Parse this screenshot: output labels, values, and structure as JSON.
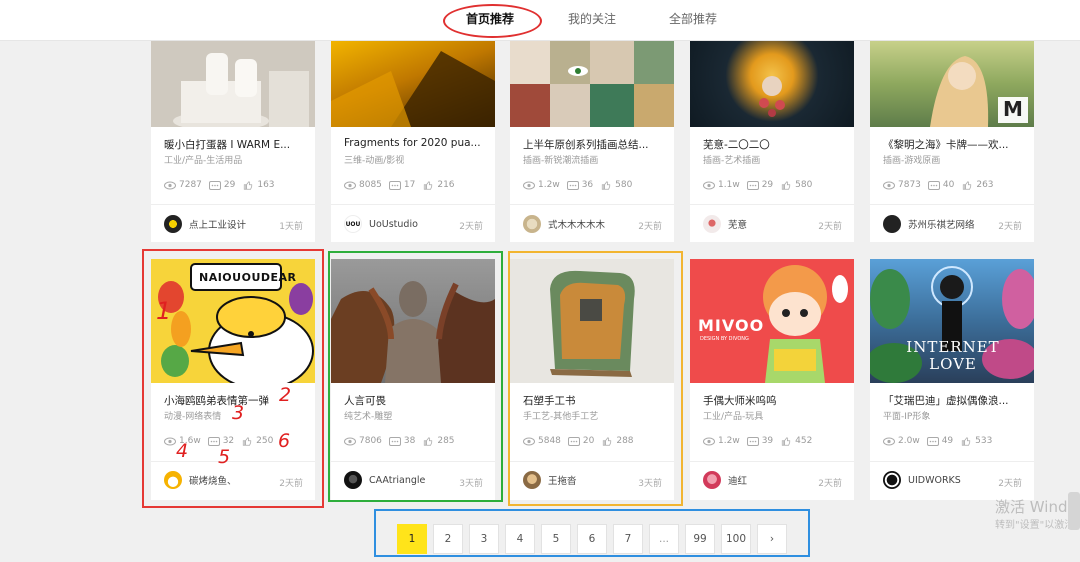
{
  "nav": {
    "tabs": [
      {
        "label": "首页推荐",
        "active": true
      },
      {
        "label": "我的关注",
        "active": false
      },
      {
        "label": "全部推荐",
        "active": false
      }
    ]
  },
  "cards_top": [
    {
      "title": "暖小白打蛋器 I WARM E...",
      "category": "工业/产品-生活用品",
      "views": "7287",
      "comments": "29",
      "likes": "163",
      "author": "点上工业设计",
      "time": "1天前"
    },
    {
      "title": "Fragments for 2020 pua...",
      "category": "三维-动画/影视",
      "views": "8085",
      "comments": "17",
      "likes": "216",
      "author": "UoUstudio",
      "avatar_text": "UOU",
      "time": "2天前"
    },
    {
      "title": "上半年原创系列插画总结...",
      "category": "插画-新锐潮流插画",
      "views": "1.2w",
      "comments": "36",
      "likes": "580",
      "author": "式木木木木木",
      "time": "2天前"
    },
    {
      "title": "芜意-二〇二〇",
      "category": "插画-艺术插画",
      "views": "1.1w",
      "comments": "29",
      "likes": "580",
      "author": "芜意",
      "time": "2天前"
    },
    {
      "title": "《黎明之海》卡牌——欢...",
      "category": "插画-游戏原画",
      "views": "7873",
      "comments": "40",
      "likes": "263",
      "author": "苏州乐祺艺网络",
      "time": "2天前",
      "thumb_logo": "M"
    }
  ],
  "cards_bottom": [
    {
      "title": "小海鸥鸥弟表情第一弹",
      "category": "动漫-网络表情",
      "views": "1.6w",
      "comments": "32",
      "likes": "250",
      "author": "碳烤烧鱼、",
      "time": "2天前",
      "thumb_text": "NAIOUOUDEAR"
    },
    {
      "title": "人言可畏",
      "category": "纯艺术-雕塑",
      "views": "7806",
      "comments": "38",
      "likes": "285",
      "author": "CAAtriangle",
      "time": "3天前"
    },
    {
      "title": "石塑手工书",
      "category": "手工艺-其他手工艺",
      "views": "5848",
      "comments": "20",
      "likes": "288",
      "author": "王拖沓",
      "time": "3天前"
    },
    {
      "title": "手偶大师米呜呜",
      "category": "工业/产品-玩具",
      "views": "1.2w",
      "comments": "39",
      "likes": "452",
      "author": "迪红",
      "time": "2天前",
      "thumb_text": "MIVOO",
      "thumb_subtext": "DESIGN BY DIVONG"
    },
    {
      "title": "「艾瑞巴迪」虚拟偶像浪...",
      "category": "平面-IP形象",
      "views": "2.0w",
      "comments": "49",
      "likes": "533",
      "author": "UIDWORKS",
      "time": "2天前",
      "thumb_text": "INTERNET LOVE"
    }
  ],
  "annotations": {
    "numbers": [
      "1",
      "2",
      "3",
      "4",
      "5",
      "6"
    ],
    "colors": {
      "red": "#e53935",
      "green": "#2eae3c",
      "orange": "#f2b531",
      "blue": "#2f8fe0"
    }
  },
  "pager": {
    "pages": [
      "1",
      "2",
      "3",
      "4",
      "5",
      "6",
      "7",
      "...",
      "99",
      "100",
      "›"
    ],
    "current": "1"
  },
  "watermark": {
    "line1": "激活 Windo",
    "line2": "转到\"设置\"以激活"
  }
}
